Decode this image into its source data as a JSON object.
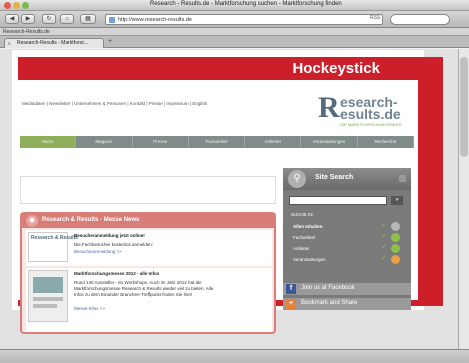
{
  "window": {
    "title": "Research - Results.de - Marktforschung suchen - Marktforschung finden"
  },
  "toolbar": {
    "url": "http://www.research-results.de",
    "back_label": "◀",
    "forward_label": "▶",
    "reload_label": "↻",
    "home_label": "⌂",
    "rss_label": "RSS"
  },
  "bookmarks": {
    "label": "Research-Results.de"
  },
  "tab": {
    "label": "Research-Results - Marktforsc...",
    "close": "x",
    "new": "+"
  },
  "banner": {
    "label": "Hockeystick",
    "color": "#cc1f2a"
  },
  "site": {
    "topnav": "Mediadaten | Newsletter | Unternehmen & Personen | Kontakt | Presse | Impressum | English",
    "logo": {
      "big_letter": "R",
      "line1": "esearch-",
      "line2": "esults.de",
      "tagline": "DIE MARKTFORSCHUNGSSEITE"
    },
    "nav": [
      {
        "label": "Home"
      },
      {
        "label": "Magazin"
      },
      {
        "label": "Presse"
      },
      {
        "label": "Fachartikel"
      },
      {
        "label": "Anbieter"
      },
      {
        "label": "Veranstaltungen"
      },
      {
        "label": "Recherche"
      }
    ]
  },
  "news": {
    "title": "Research & Results - Messe News",
    "icon": "broadcast-icon",
    "items": [
      {
        "thumb": "Research & Results",
        "headline": "Besucheranmeldung jetzt online!",
        "text": "Die Fachbesucher kostenlos anmelden:",
        "link": "Besucheranmeldung >>"
      },
      {
        "headline": "Marktforschungsmesse 2012 - alle Infos",
        "text1": "Rund 130 Aussteller - 81 Workshops. Auch im Jahr 2012 hat die",
        "text2": "Marktforschungsmesse Research & Results wieder viel zu bieten. Alle",
        "text3": "Infos zu dem Einander Branchen-Treffpunkt finden Sie hier!",
        "link": "Messe-Infos >>"
      }
    ]
  },
  "site_search": {
    "title": "Site Search",
    "go": "»",
    "heading": "SUCHE IN:",
    "options": [
      {
        "label": "Allen Inhalten",
        "color": "#b8b8b8"
      },
      {
        "label": "Fachartikel",
        "color": "#8fbf4a"
      },
      {
        "label": "Anbieter",
        "color": "#8fbf4a"
      },
      {
        "label": "Veranstaltungen",
        "color": "#e8a04a"
      }
    ]
  },
  "social": {
    "facebook": "Join us at Facebook",
    "facebook_icon": "f",
    "share": "Bookmark and Share",
    "share_icon": "+"
  }
}
